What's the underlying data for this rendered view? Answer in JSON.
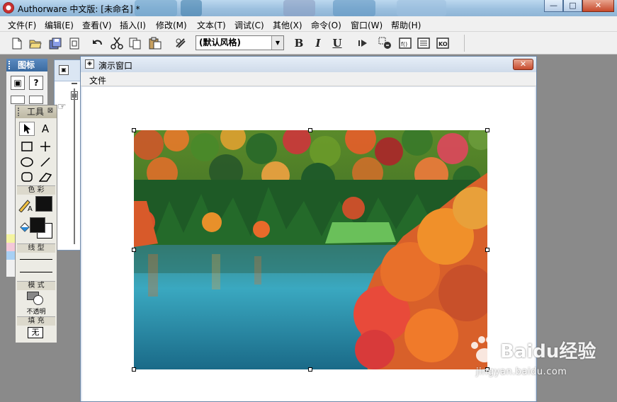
{
  "window": {
    "title": "Authorware 中文版: [未命名] *",
    "controls": {
      "minimize": "—",
      "maximize": "□",
      "close": "✕"
    }
  },
  "menubar": {
    "items": [
      "文件(F)",
      "编辑(E)",
      "查看(V)",
      "插入(I)",
      "修改(M)",
      "文本(T)",
      "调试(C)",
      "其他(X)",
      "命令(O)",
      "窗口(W)",
      "帮助(H)"
    ]
  },
  "toolbar": {
    "style_select_value": "(默认风格)",
    "bold_label": "B",
    "italic_label": "I",
    "underline_label": "U"
  },
  "icon_palette": {
    "title": "图标"
  },
  "tool_palette": {
    "title": "工具",
    "color_label": "色 彩",
    "line_label": "线 型",
    "mode_label": "模 式",
    "mode_value": "不透明",
    "fill_label": "填 充",
    "fill_value": "无"
  },
  "presentation_window": {
    "title": "演示窗口",
    "menu_file": "文件",
    "close": "✕"
  },
  "watermark": {
    "brand": "Baidu经验",
    "url": "jingyan.baidu.com"
  },
  "colors": {
    "title_gradient_top": "#bcd8ef",
    "close_button": "#c74a2c",
    "palette_header": "#3a6aa0"
  }
}
